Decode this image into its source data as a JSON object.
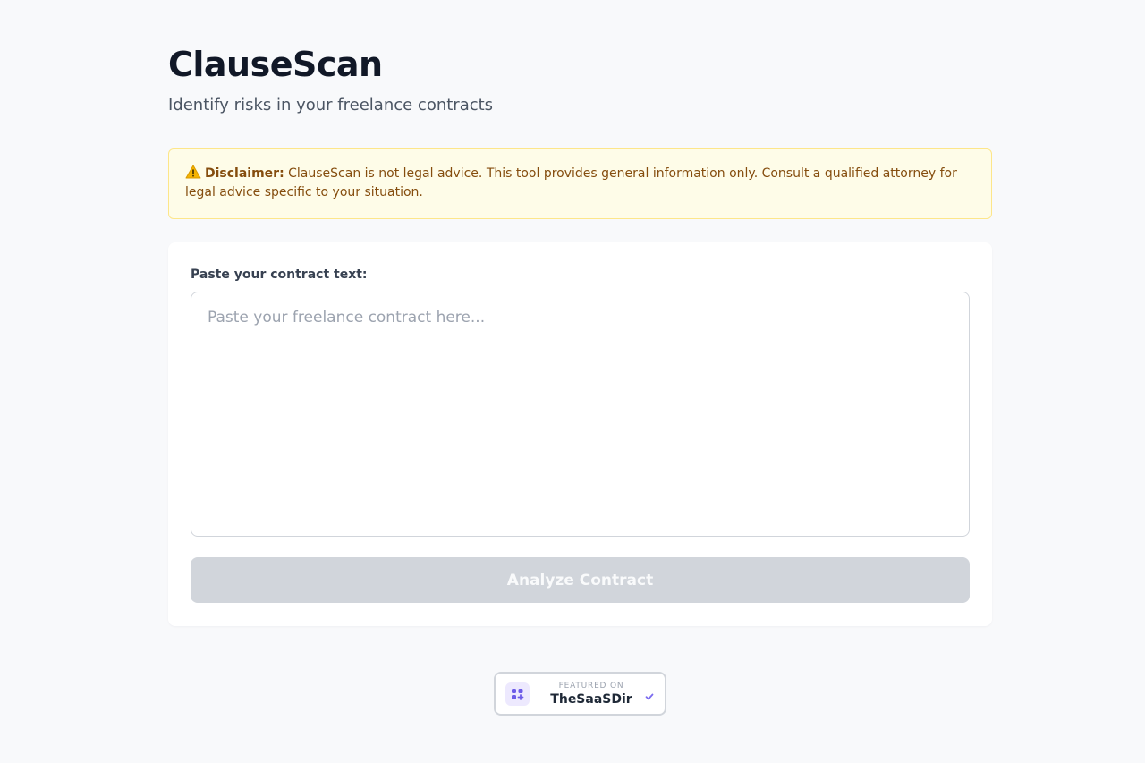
{
  "app": {
    "title": "ClauseScan",
    "subtitle": "Identify risks in your freelance contracts"
  },
  "disclaimer": {
    "icon": "warning-icon",
    "label": "Disclaimer:",
    "text": " ClauseScan is not legal advice. This tool provides general information only. Consult a qualified attorney for legal advice specific to your situation."
  },
  "form": {
    "field_label": "Paste your contract text:",
    "contract_value": "",
    "contract_placeholder": "Paste your freelance contract here...",
    "submit_label": "Analyze Contract",
    "submit_disabled": true
  },
  "badge": {
    "caption": "FEATURED ON",
    "name": "TheSaaSDir",
    "logo_icon": "grid-logo-icon",
    "check_icon": "verified-check-icon"
  },
  "colors": {
    "background": "#f8f9fb",
    "disclaimer_bg": "#fefce8",
    "disclaimer_text": "#854d0e",
    "button_disabled": "#d1d5db",
    "badge_accent": "#7c6cf0"
  }
}
